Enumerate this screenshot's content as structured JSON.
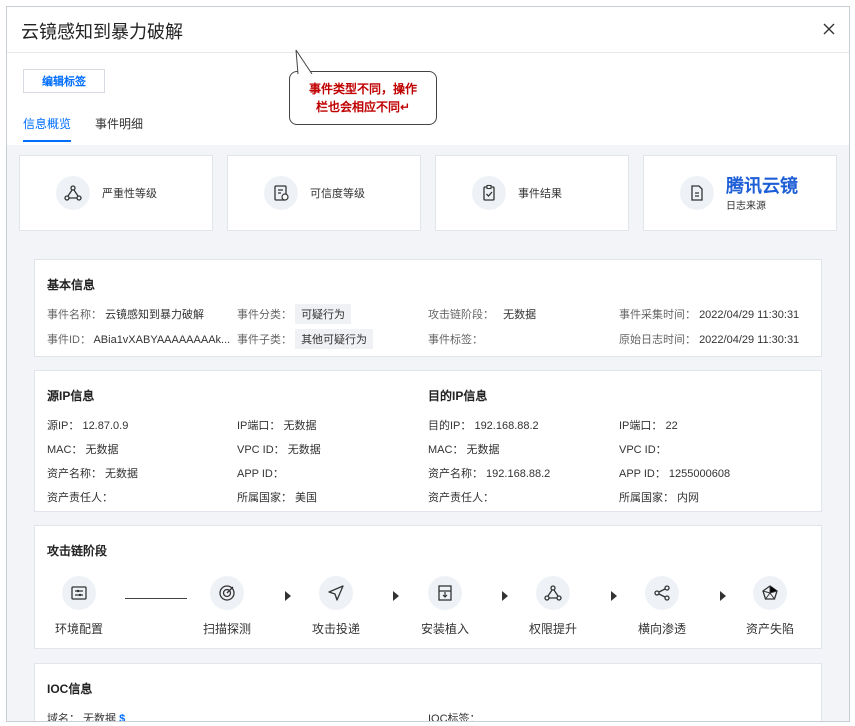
{
  "dialog": {
    "title": "云镜感知到暴力破解"
  },
  "toolbar": {
    "edit_tag": "编辑标签"
  },
  "callout": {
    "line1": "事件类型不同，操作",
    "line2": "栏也会相应不同↵"
  },
  "tabs": [
    {
      "label": "信息概览"
    },
    {
      "label": "事件明细"
    }
  ],
  "cards": {
    "severity": "严重性等级",
    "confidence": "可信度等级",
    "result": "事件结果",
    "source_brand": "腾讯云镜",
    "source_label": "日志来源"
  },
  "basic": {
    "title": "基本信息",
    "event_name_k": "事件名称：",
    "event_name_v": "云镜感知到暴力破解",
    "category_k": "事件分类：",
    "category_v": "可疑行为",
    "chain_stage_k": "攻击链阶段：",
    "chain_stage_v": "无数据",
    "collect_time_k": "事件采集时间：",
    "collect_time_v": "2022/04/29 11:30:31",
    "event_id_k": "事件ID：",
    "event_id_v": "ABia1vXABYAAAAAAAAk...",
    "subtype_k": "事件子类：",
    "subtype_v": "其他可疑行为",
    "event_tag_k": "事件标签：",
    "log_time_k": "原始日志时间：",
    "log_time_v": "2022/04/29 11:30:31"
  },
  "src_ip": {
    "title": "源IP信息",
    "ip": "源IP：  12.87.0.9",
    "port": "IP端口：  无数据",
    "mac": "MAC：  无数据",
    "vpc": "VPC ID：  无数据",
    "asset_name": "资产名称：  无数据",
    "app_id": "APP ID：",
    "owner": "资产责任人：",
    "country": "所属国家：  美国"
  },
  "dst_ip": {
    "title": "目的IP信息",
    "ip": "目的IP：  192.168.88.2",
    "port": "IP端口：  22",
    "mac": "MAC：  无数据",
    "vpc": "VPC ID：",
    "asset_name": "资产名称：  192.168.88.2",
    "app_id": "APP ID：  1255000608",
    "owner": "资产责任人：",
    "country": "所属国家：  内网"
  },
  "chain": {
    "title": "攻击链阶段",
    "stages": [
      "环境配置",
      "扫描探测",
      "攻击投递",
      "安装植入",
      "权限提升",
      "横向渗透",
      "资产失陷"
    ]
  },
  "ioc": {
    "title": "IOC信息",
    "domain": "域名：  无数据",
    "tag": "IOC标签："
  },
  "colors": {
    "accent": "#006eff",
    "brand": "#1f5fd6",
    "callout_text": "#c00000"
  }
}
